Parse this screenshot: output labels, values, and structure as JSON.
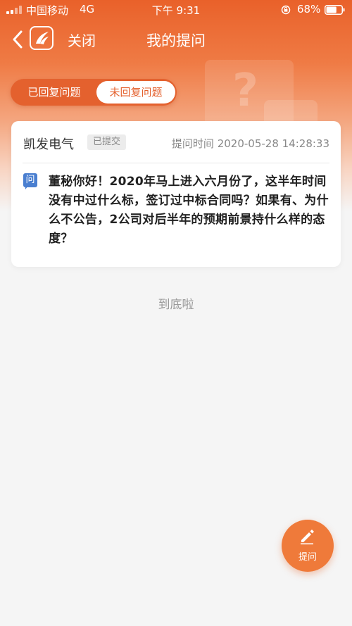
{
  "status_bar": {
    "carrier": "中国移动",
    "network": "4G",
    "time": "下午 9:31",
    "battery_percent": "68%",
    "battery_level": 0.68
  },
  "nav": {
    "close_label": "关闭",
    "title": "我的提问"
  },
  "tabs": [
    {
      "label": "已回复问题",
      "active": false
    },
    {
      "label": "未回复问题",
      "active": true
    }
  ],
  "questions": [
    {
      "company": "凯发电气",
      "status": "已提交",
      "time_label": "提问时间 2020-05-28 14:28:33",
      "badge": "问",
      "text": "董秘你好！2020年马上进入六月份了，这半年时间没有中过什么标，签订过中标合同吗？如果有、为什么不公告，2公司对后半年的预期前景持什么样的态度？"
    }
  ],
  "list_end_text": "到底啦",
  "fab": {
    "label": "提问",
    "icon": "pencil-icon"
  },
  "colors": {
    "accent": "#e9612a",
    "question_badge": "#4a7fd0"
  }
}
